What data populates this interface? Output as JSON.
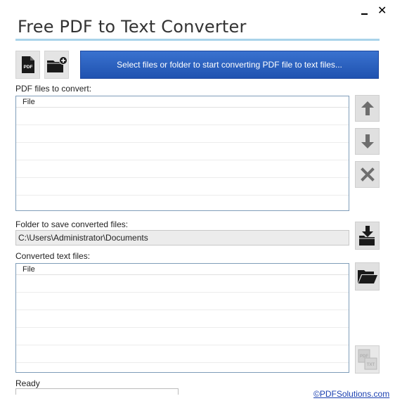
{
  "window": {
    "title": "Free PDF to Text Converter",
    "minimize_icon": "minimize-icon",
    "close_label": "✕"
  },
  "toolbar": {
    "add_pdf_icon_text": "PDF",
    "start_button_label": "Select files or folder to start converting PDF file to text files..."
  },
  "pdf_files": {
    "label": "PDF files to convert:",
    "column_header": "File",
    "rows": [
      "",
      "",
      "",
      "",
      "",
      ""
    ]
  },
  "output_folder": {
    "label": "Folder to save converted files:",
    "path": "C:\\Users\\Administrator\\Documents"
  },
  "converted_files": {
    "label": "Converted text files:",
    "column_header": "File",
    "rows": [
      "",
      "",
      "",
      "",
      "",
      ""
    ]
  },
  "side_icons": {
    "up": "arrow-up-icon",
    "down": "arrow-down-icon",
    "remove": "x-icon",
    "save_folder": "download-folder-icon",
    "open_folder": "open-folder-icon",
    "pdf_txt": "pdf-to-txt-icon"
  },
  "pdf_txt_icon_text": {
    "pdf": "PDF",
    "txt": "TXT"
  },
  "status": {
    "text": "Ready",
    "progress": 0,
    "link": "©PDFSolutions.com"
  },
  "colors": {
    "accent_blue": "#2a5fc0",
    "title_rule": "#a9d3ea",
    "tile_gray": "#e4e4e4"
  }
}
